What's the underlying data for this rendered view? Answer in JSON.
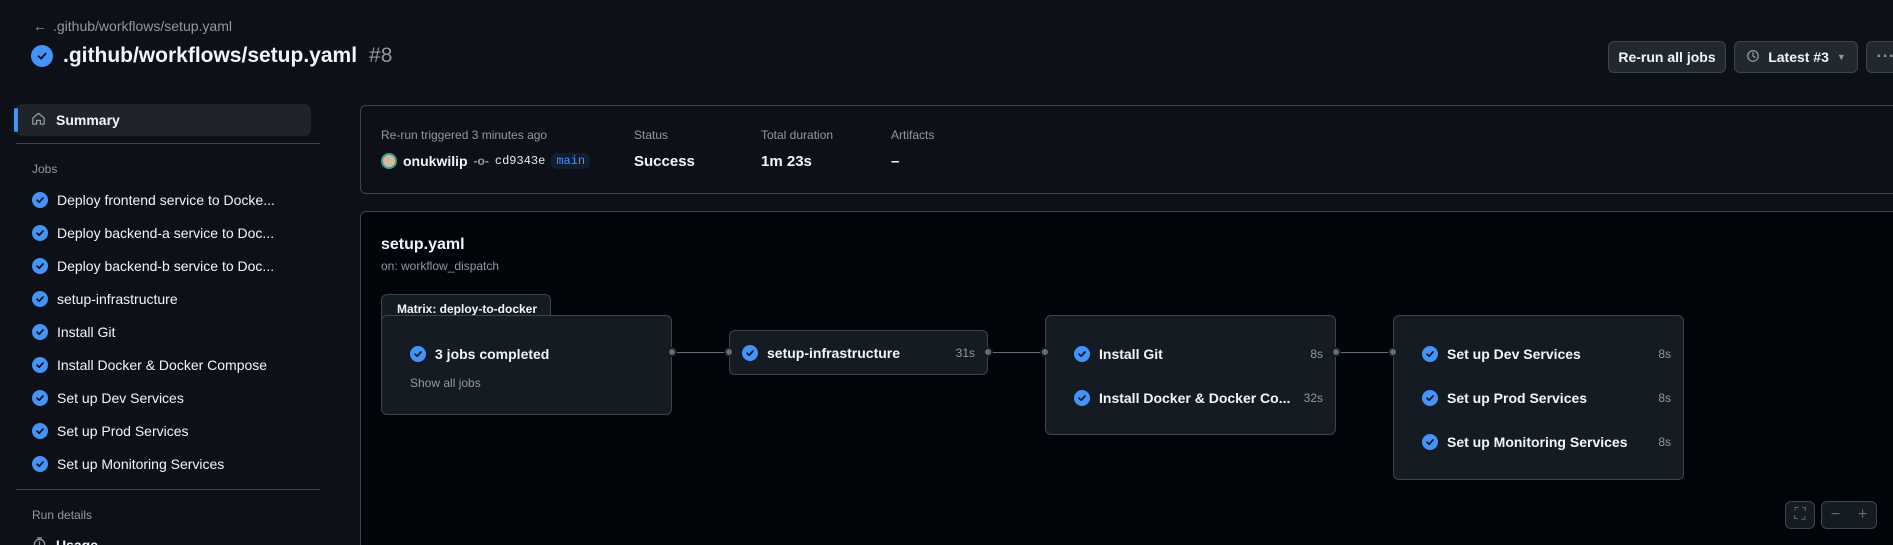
{
  "header": {
    "back_link": ".github/workflows/setup.yaml",
    "title": ".github/workflows/setup.yaml",
    "run_number": "#8",
    "rerun_button": "Re-run all jobs",
    "latest_button": "Latest #3"
  },
  "sidebar": {
    "summary": "Summary",
    "jobs_label": "Jobs",
    "jobs": [
      "Deploy frontend service to Docke...",
      "Deploy backend-a service to Doc...",
      "Deploy backend-b service to Doc...",
      "setup-infrastructure",
      "Install Git",
      "Install Docker & Docker Compose",
      "Set up Dev Services",
      "Set up Prod Services",
      "Set up Monitoring Services"
    ],
    "run_details_label": "Run details",
    "usage": "Usage"
  },
  "info": {
    "trigger_label": "Re-run triggered 3 minutes ago",
    "user": "onukwilip",
    "commit": "cd9343e",
    "branch": "main",
    "status_label": "Status",
    "status_value": "Success",
    "duration_label": "Total duration",
    "duration_value": "1m 23s",
    "artifacts_label": "Artifacts",
    "artifacts_value": "–"
  },
  "graph": {
    "workflow_name": "setup.yaml",
    "trigger": "on: workflow_dispatch",
    "matrix_title": "Matrix: deploy-to-docker",
    "matrix_status": "3 jobs completed",
    "show_all": "Show all jobs",
    "setup_infra": {
      "label": "setup-infrastructure",
      "duration": "31s"
    },
    "install_git": {
      "label": "Install Git",
      "duration": "8s"
    },
    "install_docker": {
      "label": "Install Docker & Docker Co...",
      "duration": "32s"
    },
    "dev_services": {
      "label": "Set up Dev Services",
      "duration": "8s"
    },
    "prod_services": {
      "label": "Set up Prod Services",
      "duration": "8s"
    },
    "monitoring_services": {
      "label": "Set up Monitoring Services",
      "duration": "8s"
    }
  },
  "colors": {
    "accent": "#4493f8",
    "background": "#0d1117",
    "canvas": "#010409",
    "border": "#3d444d"
  }
}
